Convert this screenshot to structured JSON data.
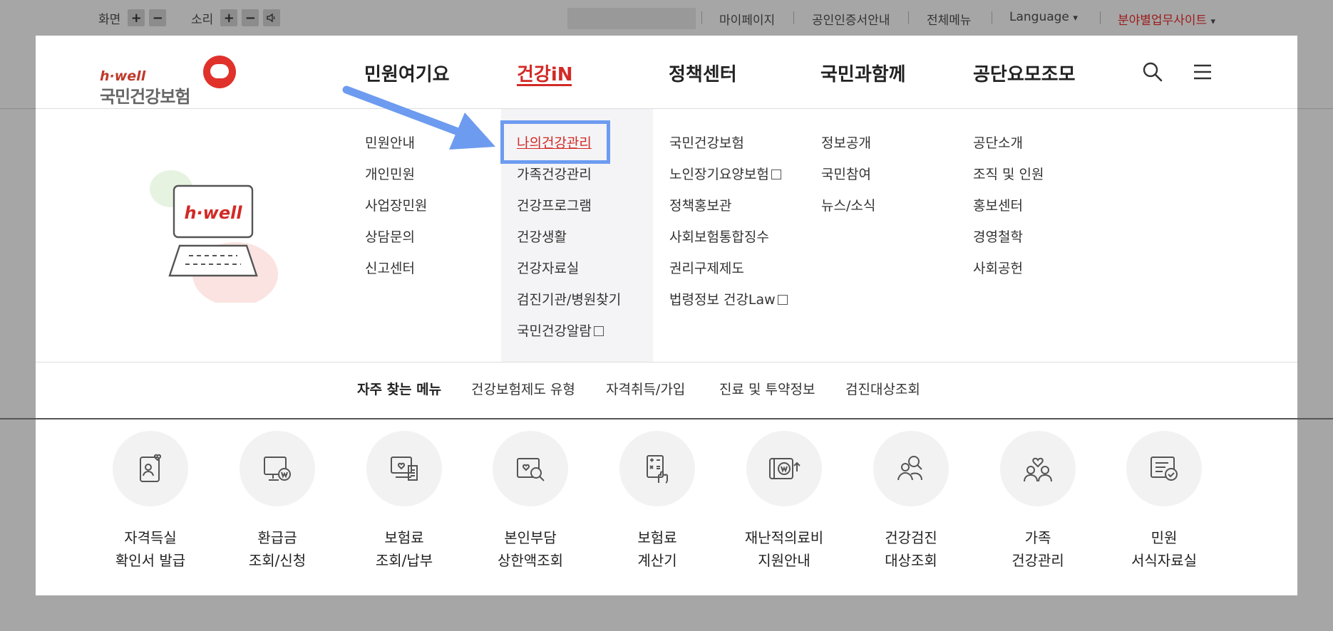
{
  "topbar": {
    "screen_label": "화면",
    "sound_label": "소리",
    "plus": "+",
    "minus": "−",
    "links": [
      "마이페이지",
      "공인인증서안내",
      "전체메뉴"
    ],
    "language": "Language",
    "field_sites": "분야별업무사이트",
    "dropdown_arrow": "▾"
  },
  "logo": {
    "hwell": "h·well",
    "name": "국민건강보험"
  },
  "gnb": [
    "민원여기요",
    "건강iN",
    "정책센터",
    "국민과함께",
    "공단요모조모"
  ],
  "gnb_active_index": 1,
  "megamenu": {
    "col1": [
      "민원안내",
      "개인민원",
      "사업장민원",
      "상담문의",
      "신고센터"
    ],
    "col2": [
      "나의건강관리",
      "가족건강관리",
      "건강프로그램",
      "건강생활",
      "건강자료실",
      "검진기관/병원찾기",
      "국민건강알람"
    ],
    "col3": [
      "국민건강보험",
      "노인장기요양보험",
      "정책홍보관",
      "사회보험통합징수",
      "권리구제제도",
      "법령정보 건강Law"
    ],
    "col4": [
      "정보공개",
      "국민참여",
      "뉴스/소식"
    ],
    "col5": [
      "공단소개",
      "조직 및 인원",
      "홍보센터",
      "경영철학",
      "사회공헌"
    ]
  },
  "illustration_text": "h·well",
  "frequent": {
    "title": "자주 찾는 메뉴",
    "items": [
      "건강보험제도 유형",
      "자격취득/가입",
      "진료 및 투약정보",
      "검진대상조회"
    ]
  },
  "services": [
    {
      "line1": "자격득실",
      "line2": "확인서 발급",
      "icon": "person-card-heart-icon"
    },
    {
      "line1": "환급금",
      "line2": "조회/신청",
      "icon": "monitor-won-icon"
    },
    {
      "line1": "보험료",
      "line2": "조회/납부",
      "icon": "computer-document-icon"
    },
    {
      "line1": "본인부담",
      "line2": "상한액조회",
      "icon": "card-search-icon"
    },
    {
      "line1": "보험료",
      "line2": "계산기",
      "icon": "calculator-hand-icon"
    },
    {
      "line1": "재난적의료비",
      "line2": "지원안내",
      "icon": "wallet-won-up-icon"
    },
    {
      "line1": "건강검진",
      "line2": "대상조회",
      "icon": "people-search-icon"
    },
    {
      "line1": "가족",
      "line2": "건강관리",
      "icon": "family-heart-icon"
    },
    {
      "line1": "민원",
      "line2": "서식자료실",
      "icon": "document-check-icon"
    }
  ],
  "colors": {
    "accent_red": "#d22a26",
    "highlight_blue": "#6d9bf0",
    "overlay_gray": "#a6a6a6"
  }
}
